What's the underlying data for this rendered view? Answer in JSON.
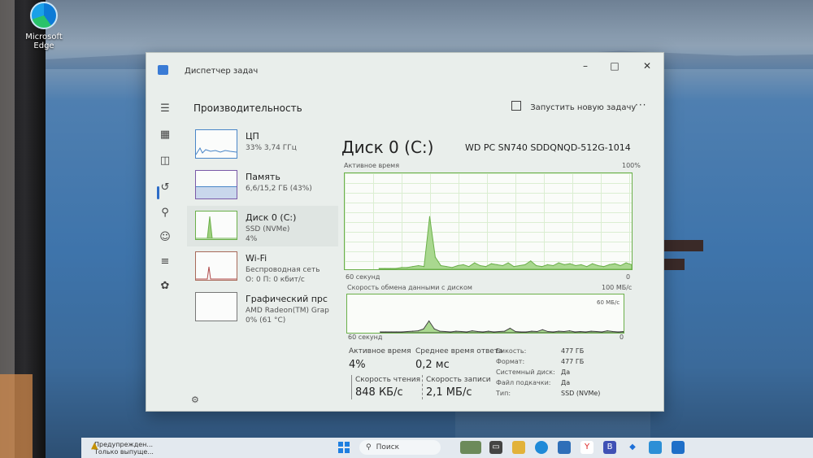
{
  "desktop": {
    "icon_label_1": "Microsoft",
    "icon_label_2": "Edge"
  },
  "window": {
    "title": "Диспетчер задач",
    "section_title": "Производительность",
    "new_task_label": "Запустить новую задачу",
    "more_label": "···",
    "icons": [
      "menu-icon",
      "processes-icon",
      "performance-icon",
      "history-icon",
      "startup-icon",
      "users-icon",
      "details-icon",
      "services-icon",
      "settings-icon"
    ]
  },
  "perf_items": [
    {
      "label": "ЦП",
      "sub": "33% 3,74 ГГц",
      "sub2": ""
    },
    {
      "label": "Память",
      "sub": "6,6/15,2 ГБ (43%)",
      "sub2": ""
    },
    {
      "label": "Диск 0 (C:)",
      "sub": "SSD (NVMe)",
      "sub2": "4%"
    },
    {
      "label": "Wi-Fi",
      "sub": "Беспроводная сеть",
      "sub2": "О: 0 П: 0 кбит/с"
    },
    {
      "label": "Графический прс",
      "sub": "AMD Radeon(TM) Grap",
      "sub2": "0% (61 °C)"
    }
  ],
  "disk": {
    "title": "Диск 0 (C:)",
    "model": "WD PC SN740 SDDQNQD-512G-1014",
    "active_time_label": "Активное время",
    "active_time_max": "100%",
    "graph1_left": "60 секунд",
    "graph1_right": "0",
    "transfer_label": "Скорость обмена данными с диском",
    "transfer_max": "100 МБ/с",
    "transfer_mid": "60 МБ/с",
    "graph2_left": "60 секунд",
    "graph2_right": "0"
  },
  "stats": {
    "active_label": "Активное время",
    "active_value": "4%",
    "resp_label": "Среднее время ответа",
    "resp_value": "0,2 мс",
    "read_label": "Скорость чтения",
    "read_value": "848 КБ/с",
    "write_label": "Скорость записи",
    "write_value": "2,1 МБ/с"
  },
  "props": [
    {
      "k": "Емкость:",
      "v": "477 ГБ"
    },
    {
      "k": "Формат:",
      "v": "477 ГБ"
    },
    {
      "k": "Системный диск:",
      "v": "Да"
    },
    {
      "k": "Файл подкачки:",
      "v": "Да"
    },
    {
      "k": "Тип:",
      "v": "SSD (NVMe)"
    }
  ],
  "chart_data": {
    "type": "area",
    "series": [
      {
        "values": [
          0,
          0,
          0,
          0,
          1,
          1,
          2,
          3,
          2,
          55,
          12,
          3,
          2,
          1,
          3,
          4,
          2,
          6,
          3,
          2,
          5,
          4,
          3,
          6,
          2,
          3,
          4,
          8,
          3,
          2,
          4,
          3,
          6,
          4,
          5,
          3,
          4,
          2,
          5,
          3,
          2,
          4,
          5,
          3,
          6,
          4
        ]
      },
      {
        "values": [
          0,
          0,
          0,
          0,
          0,
          1,
          2,
          3,
          8,
          30,
          8,
          2,
          1,
          0,
          2,
          1,
          0,
          3,
          1,
          0,
          2,
          0,
          1,
          2,
          10,
          1,
          0,
          0,
          2,
          1,
          6,
          1,
          0,
          2,
          1,
          3,
          0,
          1,
          0,
          2,
          1,
          0,
          3,
          1,
          0,
          1
        ]
      }
    ]
  },
  "taskbar": {
    "warn_line1": "Предупрежден...",
    "warn_line2": "Только выпуще...",
    "search_label": "Поиск"
  }
}
